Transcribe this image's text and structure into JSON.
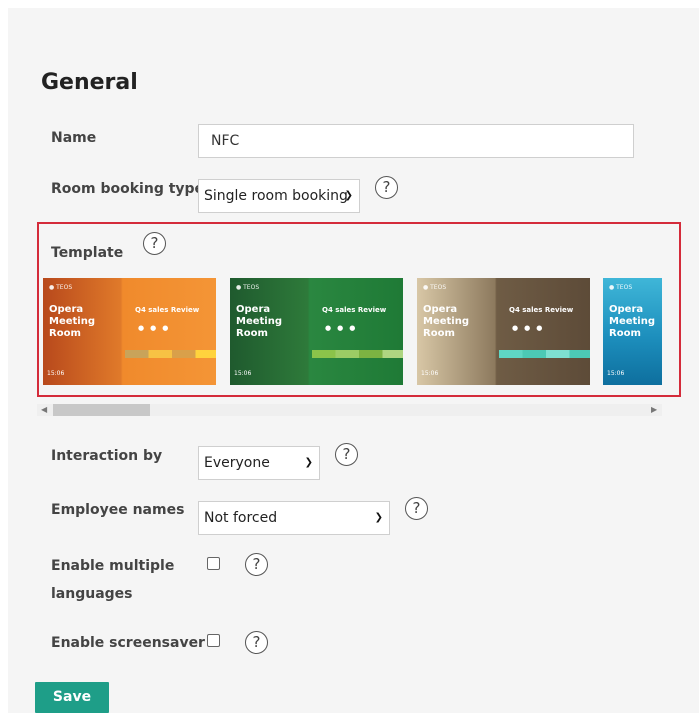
{
  "section": {
    "title": "General"
  },
  "fields": {
    "name": {
      "label": "Name",
      "value": "NFC"
    },
    "room_booking_type": {
      "label": "Room booking type",
      "value": "Single room booking"
    },
    "template": {
      "label": "Template"
    },
    "interaction_by": {
      "label": "Interaction by",
      "value": "Everyone"
    },
    "employee_names": {
      "label": "Employee names",
      "value": "Not forced"
    },
    "enable_multiple_languages": {
      "label_line1": "Enable multiple",
      "label_line2": "languages",
      "checked": false
    },
    "enable_screensaver": {
      "label": "Enable screensaver",
      "checked": false
    }
  },
  "templates": [
    {
      "name": "Opera Meeting Room",
      "review": "Q4 sales Review",
      "time": "15:06",
      "theme": "autumn-orange"
    },
    {
      "name": "Opera Meeting Room",
      "review": "Q4 sales Review",
      "time": "15:06",
      "theme": "leaf-green"
    },
    {
      "name": "Opera Meeting Room",
      "review": "Q4 sales Review",
      "time": "15:06",
      "theme": "misty-brown"
    },
    {
      "name": "Opera Meeting Room",
      "time": "15:06",
      "theme": "ocean-blue"
    }
  ],
  "help_glyph": "?",
  "save_label": "Save",
  "icons": {
    "help": "question-circle-icon",
    "caret": "chevron-down-icon",
    "scroll_left": "triangle-left-icon",
    "scroll_right": "triangle-right-icon"
  },
  "colors": {
    "accent": "#1e9e88",
    "highlight_border": "#d42b3a"
  }
}
